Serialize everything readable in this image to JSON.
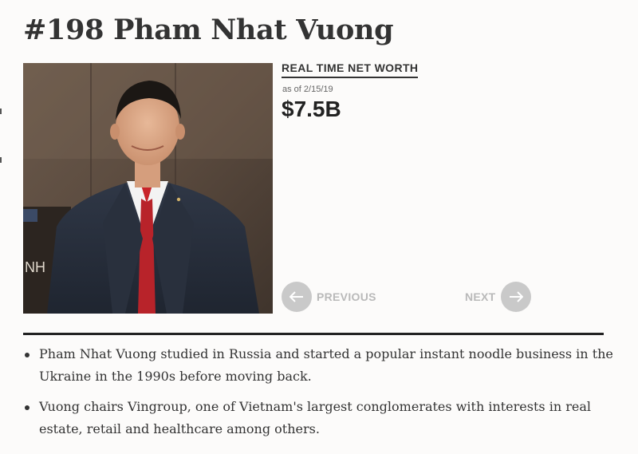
{
  "profile": {
    "rank_name": "#198 Pham Nhat Vuong",
    "photo_alt": "Pham Nhat Vuong"
  },
  "net_worth": {
    "label": "REAL TIME NET WORTH",
    "as_of": "as of 2/15/19",
    "value": "$7.5B"
  },
  "navigation": {
    "previous_label": "PREVIOUS",
    "next_label": "NEXT",
    "previous_icon": "arrow-left-icon",
    "next_icon": "arrow-right-icon"
  },
  "facts": [
    "Pham Nhat Vuong studied in Russia and started a popular instant noodle business in the Ukraine in the 1990s before moving back.",
    "Vuong chairs Vingroup, one of Vietnam's largest conglomerates with interests in real estate, retail and healthcare among others."
  ],
  "colors": {
    "background": "#fcfbfa",
    "text": "#2b2b2b",
    "nav_disabled": "#c9c9c9"
  }
}
